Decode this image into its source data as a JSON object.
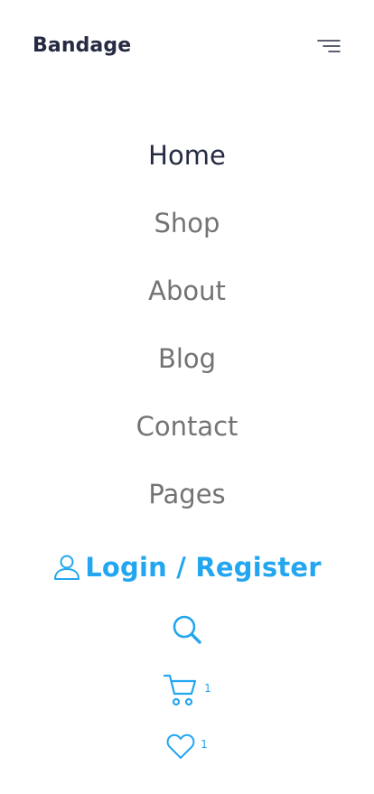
{
  "brand": {
    "name": "Bandage"
  },
  "nav": {
    "items": [
      {
        "label": "Home",
        "active": true
      },
      {
        "label": "Shop",
        "active": false
      },
      {
        "label": "About",
        "active": false
      },
      {
        "label": "Blog",
        "active": false
      },
      {
        "label": "Contact",
        "active": false
      },
      {
        "label": "Pages",
        "active": false
      }
    ]
  },
  "actions": {
    "login_label": "Login / Register",
    "cart_count": "1",
    "wishlist_count": "1"
  },
  "icons": {
    "menu": "menu-icon",
    "user": "user-icon",
    "search": "search-icon",
    "cart": "cart-icon",
    "heart": "heart-icon"
  },
  "colors": {
    "primary": "#23A6F0",
    "dark": "#252B42",
    "muted": "#737373"
  }
}
